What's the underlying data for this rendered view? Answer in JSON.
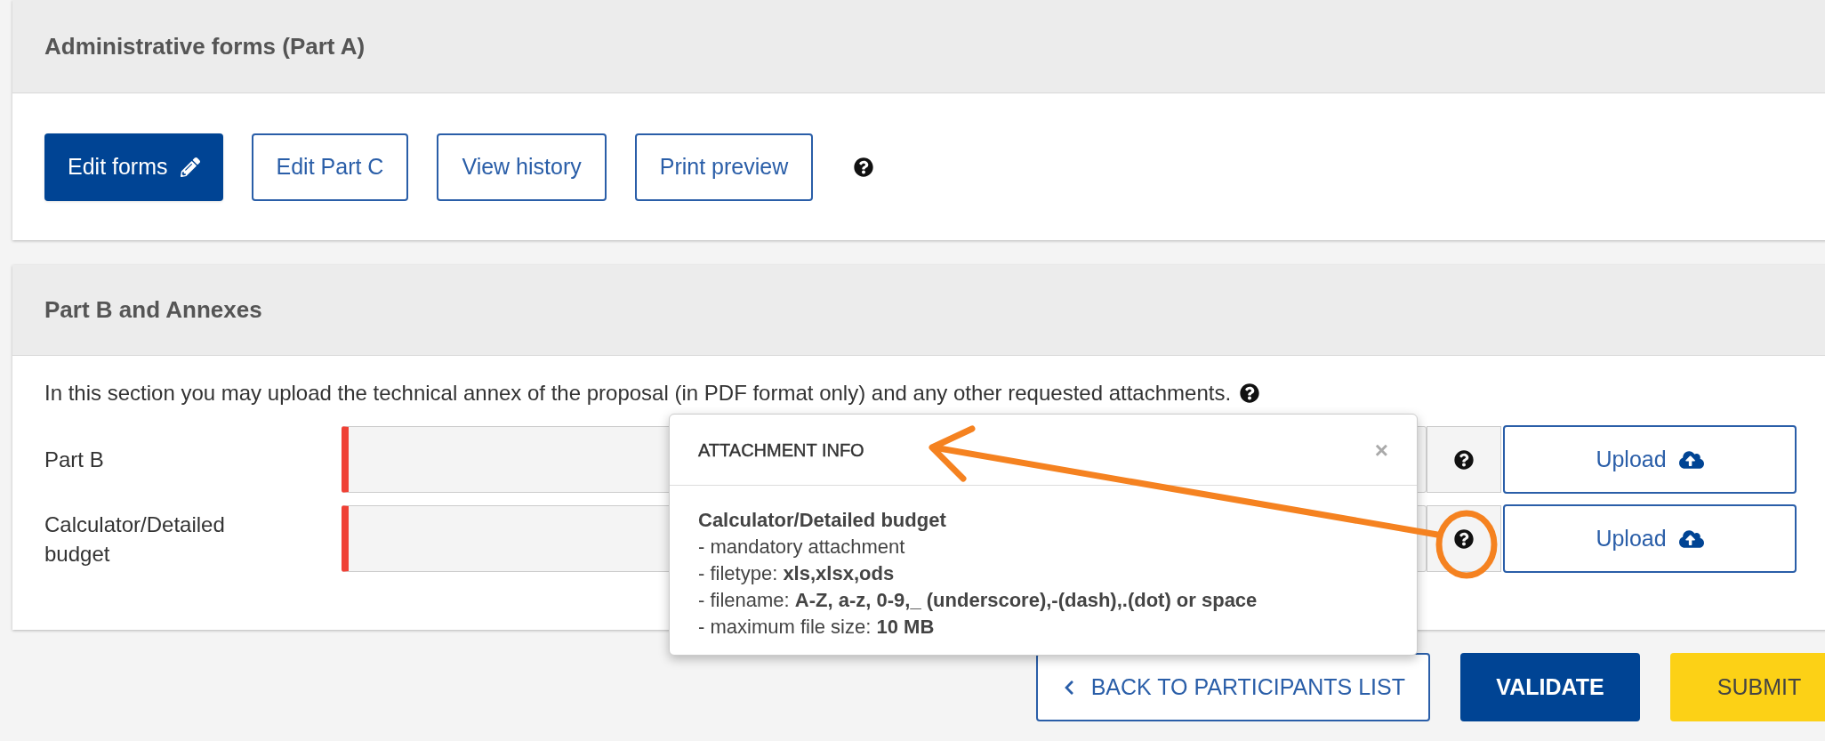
{
  "part_a": {
    "title": "Administrative forms (Part A)",
    "buttons": [
      {
        "label": "Edit forms",
        "kind": "primary"
      },
      {
        "label": "Edit Part C",
        "kind": "outline"
      },
      {
        "label": "View history",
        "kind": "outline"
      },
      {
        "label": "Print preview",
        "kind": "outline"
      }
    ]
  },
  "part_b": {
    "title": "Part B and Annexes",
    "intro": "In this section you may upload the technical annex of the proposal (in PDF format only) and any other requested attachments.",
    "rows": [
      {
        "label": "Part B",
        "required": true,
        "upload": "Upload",
        "annotated": false
      },
      {
        "label": "Calculator/Detailed budget",
        "required": true,
        "upload": "Upload",
        "annotated": true
      }
    ]
  },
  "popover": {
    "title": "ATTACHMENT INFO",
    "close": "×",
    "heading": "Calculator/Detailed budget",
    "lines": [
      "- mandatory attachment",
      "- filetype: **xls,xlsx,ods**",
      "- filename: **A-Z, a-z, 0-9,_ (underscore),-(dash),.(dot) or space**",
      "- maximum file size: **10 MB**"
    ]
  },
  "footer_buttons": [
    {
      "label": "BACK TO PARTICIPANTS LIST",
      "kind": "back"
    },
    {
      "label": "VALIDATE",
      "kind": "primary"
    },
    {
      "label": "SUBMIT",
      "kind": "warning"
    }
  ]
}
